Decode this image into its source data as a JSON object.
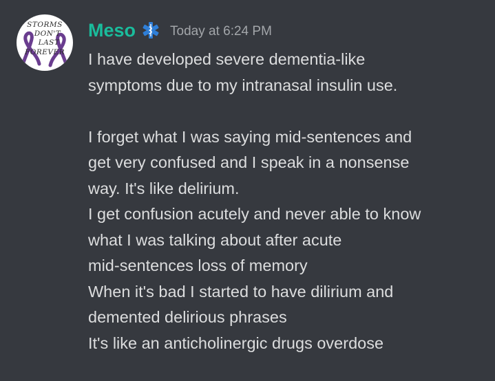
{
  "message": {
    "author": {
      "username": "Meso",
      "username_color": "#1abc9c",
      "role_icon": "medical-caduceus-icon",
      "avatar": {
        "lines": [
          "STORMS",
          "DON'T",
          "LAST",
          "FOREVER"
        ],
        "ribbon_color": "#6a3d8f"
      }
    },
    "timestamp": "Today at 6:24 PM",
    "lines": [
      "I have developed severe dementia-like",
      "symptoms due to my intranasal insulin use.",
      "",
      "I forget what I was saying mid-sentences and",
      "get very confused and I speak in a nonsense",
      "way. It's like delirium.",
      "I get confusion acutely and never able to know",
      "what I was talking about after acute",
      "mid-sentences loss of memory",
      "When it's bad I started to have dilirium and",
      "demented delirious phrases",
      "It's like an anticholinergic drugs overdose"
    ]
  },
  "theme": {
    "background": "#36393f",
    "text": "#dcddde",
    "muted": "#a3a6aa"
  }
}
